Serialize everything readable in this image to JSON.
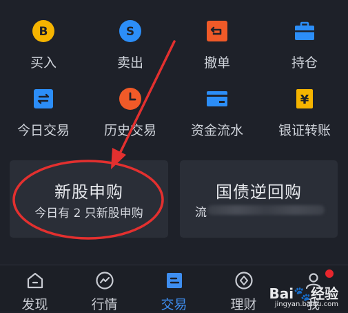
{
  "actions_row1": [
    {
      "label": "买入",
      "icon": "buy-icon",
      "icon_letter": "B",
      "color": "#f5b400"
    },
    {
      "label": "卖出",
      "icon": "sell-icon",
      "icon_letter": "S",
      "color": "#2c8ef8"
    },
    {
      "label": "撤单",
      "icon": "cancel-order-icon",
      "color": "#f05a28"
    },
    {
      "label": "持仓",
      "icon": "briefcase-icon",
      "color": "#2c8ef8"
    }
  ],
  "actions_row2": [
    {
      "label": "今日交易",
      "icon": "today-trade-icon",
      "color": "#2c8ef8"
    },
    {
      "label": "历史交易",
      "icon": "clock-icon",
      "color": "#f05a28"
    },
    {
      "label": "资金流水",
      "icon": "card-icon",
      "color": "#2c8ef8"
    },
    {
      "label": "银证转账",
      "icon": "transfer-icon",
      "icon_letter": "¥",
      "color": "#f5b400"
    }
  ],
  "cards": {
    "ipo": {
      "title": "新股申购",
      "subtitle": "今日有 2 只新股申购"
    },
    "bond": {
      "title": "国债逆回购",
      "subtitle_visible": "流"
    }
  },
  "bottom_nav": [
    {
      "label": "发现",
      "icon": "home-icon"
    },
    {
      "label": "行情",
      "icon": "chart-icon"
    },
    {
      "label": "交易",
      "icon": "trade-icon",
      "active": true
    },
    {
      "label": "理财",
      "icon": "finance-icon"
    },
    {
      "label": "我",
      "icon": "user-icon"
    }
  ],
  "colors": {
    "accent": "#3e8ef0",
    "annotation": "#e3302f",
    "badge": "#e8262d"
  },
  "watermark": {
    "brand": "Bai",
    "brand2": "经验",
    "url": "jingyan.baidu.com"
  }
}
